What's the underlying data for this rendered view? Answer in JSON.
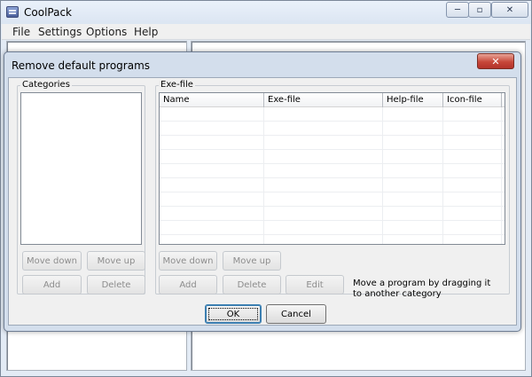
{
  "window": {
    "title": "CoolPack",
    "min_glyph": "─",
    "max_glyph": "▫",
    "close_glyph": "✕"
  },
  "menu": [
    "File",
    "Settings",
    "Options",
    "Help"
  ],
  "dialog": {
    "title": "Remove default programs",
    "close_glyph": "✕",
    "categories": {
      "label": "Categories",
      "move_down": "Move down",
      "move_up": "Move up",
      "add": "Add",
      "delete": "Delete"
    },
    "exe": {
      "label": "Exe-file",
      "columns": [
        "Name",
        "Exe-file",
        "Help-file",
        "Icon-file"
      ],
      "row_count": 10,
      "move_down": "Move down",
      "move_up": "Move up",
      "add": "Add",
      "delete": "Delete",
      "edit": "Edit",
      "hint_line1": "Move a program by dragging it",
      "hint_line2": "to another category"
    },
    "ok": "OK",
    "cancel": "Cancel"
  },
  "colors": {
    "frame": "#e3ebf5",
    "dialog_frame": "#d3deec",
    "client": "#f0f0f0",
    "close_red": "#c7473a"
  }
}
